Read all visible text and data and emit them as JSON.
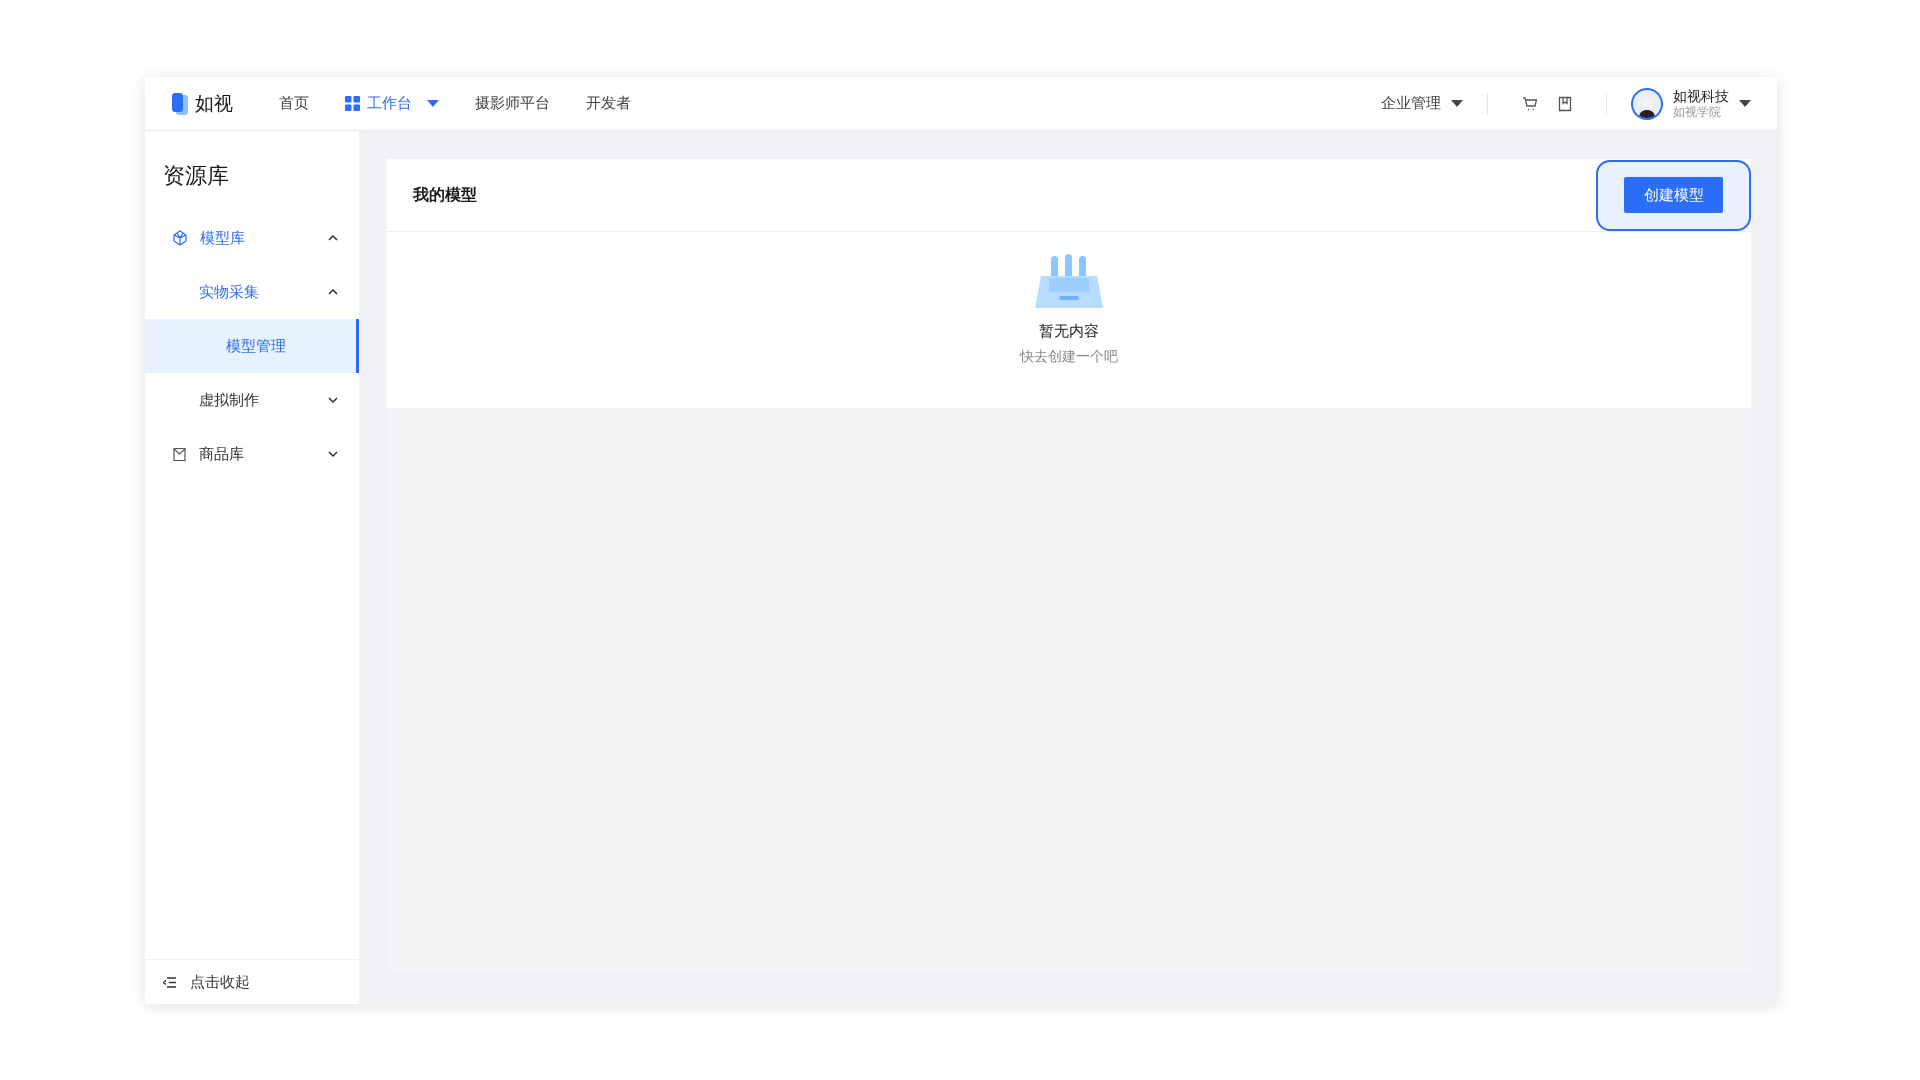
{
  "brand": {
    "name": "如视"
  },
  "nav": [
    {
      "label": "首页",
      "selected": false,
      "dropdown": false
    },
    {
      "label": "工作台",
      "selected": true,
      "dropdown": true
    },
    {
      "label": "摄影师平台",
      "selected": false,
      "dropdown": false
    },
    {
      "label": "开发者",
      "selected": false,
      "dropdown": false
    }
  ],
  "account_menu": {
    "label": "企业管理"
  },
  "user": {
    "name": "如视科技",
    "subtitle": "如视学院"
  },
  "sidebar": {
    "title": "资源库",
    "items": [
      {
        "label": "模型库",
        "kind": "cube",
        "expanded": true,
        "selected": false,
        "children": [
          {
            "label": "实物采集",
            "expanded": true,
            "selected": false,
            "children": [
              {
                "label": "模型管理",
                "selected": true
              }
            ]
          },
          {
            "label": "虚拟制作",
            "expanded": false,
            "selected": false
          }
        ]
      },
      {
        "label": "商品库",
        "kind": "bag",
        "expanded": false,
        "selected": false
      }
    ],
    "collapse": "点击收起"
  },
  "panel": {
    "title": "我的模型",
    "create_button": "创建模型",
    "empty": {
      "title": "暂无内容",
      "hint": "快去创建一个吧"
    }
  }
}
